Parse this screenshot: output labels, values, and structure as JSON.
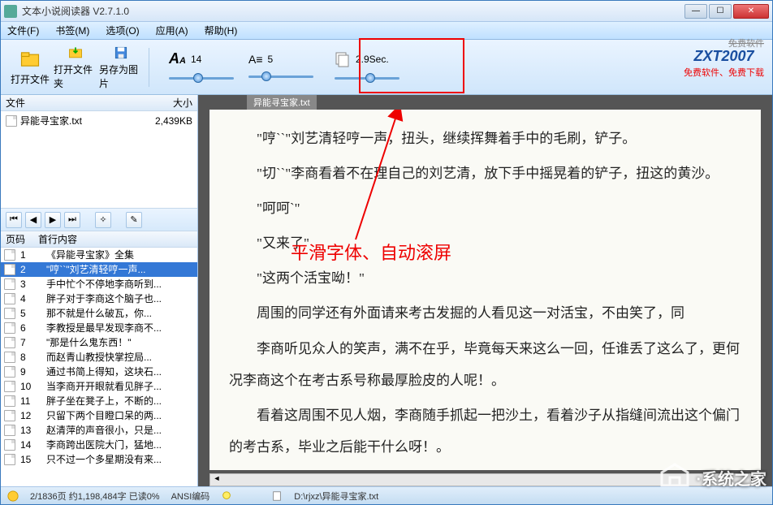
{
  "window": {
    "title": "文本小说阅读器 V2.7.1.0"
  },
  "menu": {
    "file": "文件(F)",
    "bookmark": "书签(M)",
    "options": "选项(O)",
    "apps": "应用(A)",
    "help": "帮助(H)"
  },
  "toolbar": {
    "open_file": "打开文件",
    "open_folder": "打开文件夹",
    "save_as_img": "另存为图片",
    "font_size": "14",
    "line_spacing": "5",
    "autoscroll": "2.9Sec.",
    "free_software": "免费软件",
    "brand": "ZXT",
    "brand_year": "2007",
    "brand_sub": "免费软件、免费下载"
  },
  "annotation": "平滑字体、自动滚屏",
  "sidebar": {
    "files_col_name": "文件",
    "files_col_size": "大小",
    "files": [
      {
        "name": "异能寻宝家.txt",
        "size": "2,439KB"
      }
    ],
    "pages_col_num": "页码",
    "pages_col_first": "首行内容",
    "pages": [
      {
        "n": "1",
        "t": "《异能寻宝家》全集"
      },
      {
        "n": "2",
        "t": "\"哼``\"刘艺清轻哼一声..."
      },
      {
        "n": "3",
        "t": "手中忙个不停地李商听到..."
      },
      {
        "n": "4",
        "t": "胖子对于李商这个脑子也..."
      },
      {
        "n": "5",
        "t": "那不就是什么破瓦，你..."
      },
      {
        "n": "6",
        "t": "李教授是最早发现李商不..."
      },
      {
        "n": "7",
        "t": "\"那是什么鬼东西！\""
      },
      {
        "n": "8",
        "t": "而赵青山教授快掌控局..."
      },
      {
        "n": "9",
        "t": "通过书简上得知，这块石..."
      },
      {
        "n": "10",
        "t": "当李商开开眼就看见胖子..."
      },
      {
        "n": "11",
        "t": "胖子坐在凳子上，不断的..."
      },
      {
        "n": "12",
        "t": "只留下两个目瞪口呆的两..."
      },
      {
        "n": "13",
        "t": "赵清萍的声音很小，只是..."
      },
      {
        "n": "14",
        "t": "李商跨出医院大门，猛地..."
      },
      {
        "n": "15",
        "t": "只不过一个多星期没有来..."
      }
    ],
    "selected_page": 1
  },
  "reader": {
    "tab": "异能寻宝家.txt",
    "lines": [
      "\"哼``\"刘艺清轻哼一声，扭头，继续挥舞着手中的毛刷，铲子。",
      "\"切``\"李商看着不在理自己的刘艺清，放下手中摇晃着的铲子，扭这的黄沙。",
      "\"呵呵`\"",
      "\"又来了\"",
      "\"这两个活宝呦！\"",
      "周围的同学还有外面请来考古发掘的人看见这一对活宝，不由笑了，同",
      "李商听见众人的笑声，满不在乎，毕竟每天来这么一回，任谁丢了这么了，更何况李商这个在考古系号称最厚脸皮的人呢！。",
      "看着这周围不见人烟，李商随手抓起一把沙土，看着沙子从指缝间流出这个偏门的考古系，毕业之后能干什么呀！。"
    ]
  },
  "status": {
    "pos": "2/1836页 约1,198,484字 已读0%",
    "encoding": "ANSI编码",
    "path": "D:\\rjxz\\异能寻宝家.txt"
  },
  "watermark": "·系统之家"
}
